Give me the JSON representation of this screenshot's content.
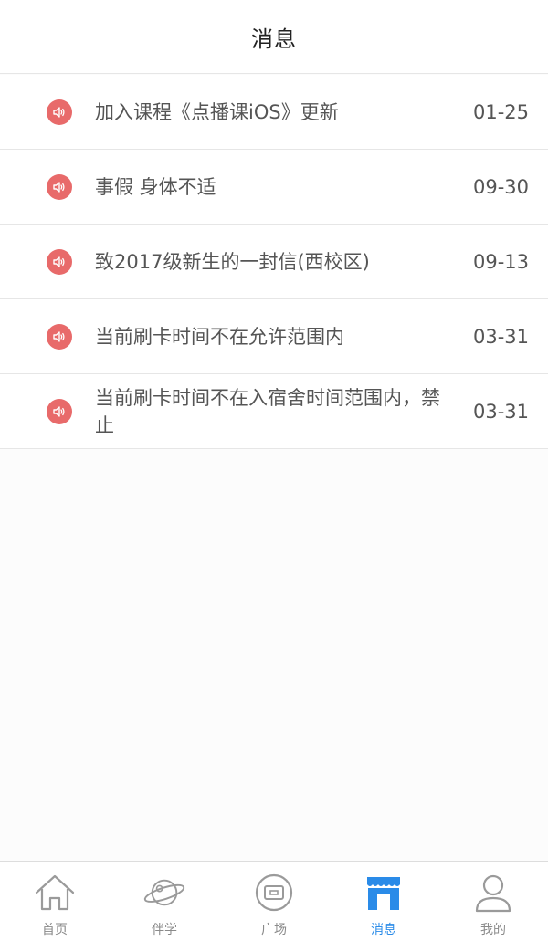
{
  "header": {
    "title": "消息"
  },
  "messages": [
    {
      "text": "加入课程《点播课iOS》更新",
      "date": "01-25",
      "icon": "speaker-icon"
    },
    {
      "text": "事假 身体不适",
      "date": "09-30",
      "icon": "speaker-icon"
    },
    {
      "text": "致2017级新生的一封信(西校区)",
      "date": "09-13",
      "icon": "speaker-icon"
    },
    {
      "text": "当前刷卡时间不在允许范围内",
      "date": "03-31",
      "icon": "speaker-icon"
    },
    {
      "text": "当前刷卡时间不在入宿舍时间范围内，禁止",
      "date": "03-31",
      "icon": "speaker-icon"
    }
  ],
  "tabbar": {
    "tabs": [
      {
        "label": "首页",
        "icon": "home-icon",
        "active": false
      },
      {
        "label": "伴学",
        "icon": "planet-icon",
        "active": false
      },
      {
        "label": "广场",
        "icon": "square-icon",
        "active": false
      },
      {
        "label": "消息",
        "icon": "store-icon",
        "active": true
      },
      {
        "label": "我的",
        "icon": "user-icon",
        "active": false
      }
    ]
  },
  "colors": {
    "accent": "#2a8be8",
    "speaker_badge": "#e86a6a",
    "text": "#555555",
    "inactive_icon": "#9a9a9a"
  }
}
